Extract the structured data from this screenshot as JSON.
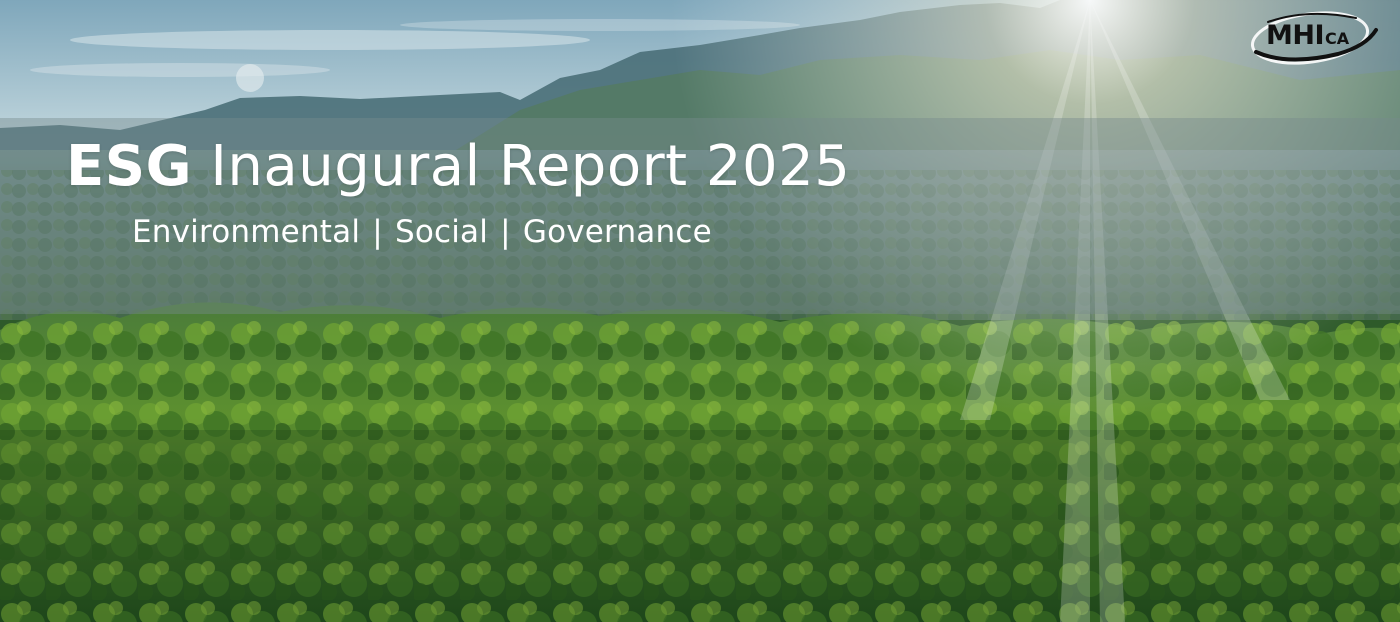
{
  "slide": {
    "title_bold": "ESG",
    "title_rest": "Inaugural Report 2025",
    "subtitle": {
      "items": [
        "Environmental",
        "Social",
        "Governance"
      ],
      "separator": "|"
    },
    "background": {
      "scene": "aerial forest with mountains and sun rays",
      "sky_color": "#a9c6d4",
      "forest_color": "#3f7a2c"
    },
    "logo": {
      "main": "MHI",
      "sub": "CA",
      "icon": "swoosh-ring-logo"
    }
  }
}
